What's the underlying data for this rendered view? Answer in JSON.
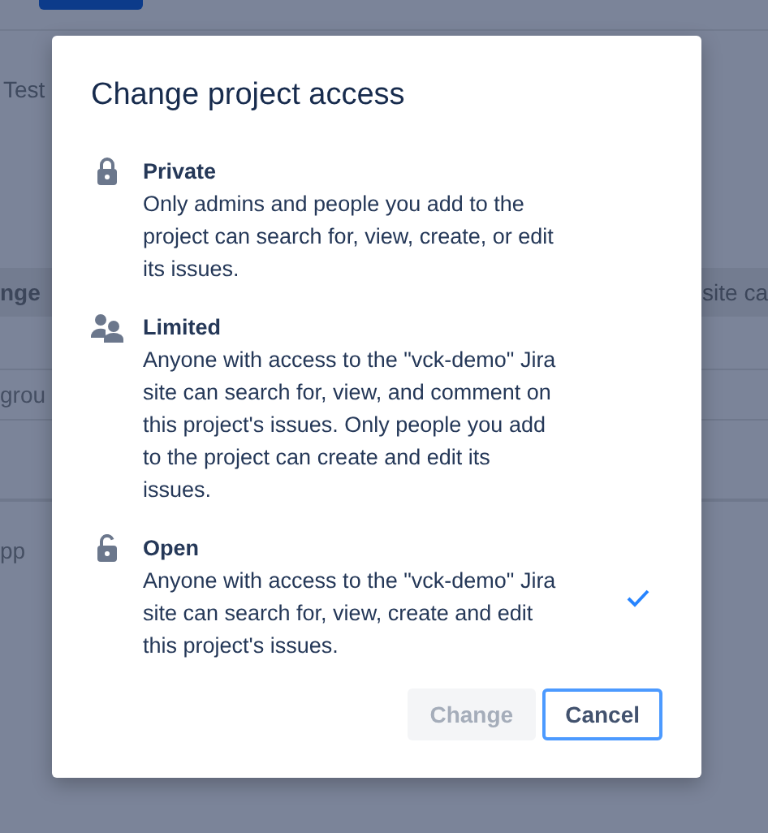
{
  "background": {
    "top_text": "Test",
    "header_left": "nge",
    "header_right": "site ca",
    "field_value": "grou",
    "row_text": "pp"
  },
  "dialog": {
    "title": "Change project access",
    "options": [
      {
        "title": "Private",
        "description": "Only admins and people you add to the project can search for, view, create, or edit its issues.",
        "selected": false
      },
      {
        "title": "Limited",
        "description": "Anyone with access to the \"vck-demo\" Jira site can search for, view, and comment on this project's issues. Only people you add to the project can create and edit its issues.",
        "selected": false
      },
      {
        "title": "Open",
        "description": "Anyone with access to the \"vck-demo\" Jira site can search for, view, create and edit this project's issues.",
        "selected": true
      }
    ],
    "buttons": [
      {
        "label": "Change",
        "disabled": true,
        "kind": "primary"
      },
      {
        "label": "Cancel",
        "disabled": false,
        "kind": "secondary"
      }
    ]
  }
}
